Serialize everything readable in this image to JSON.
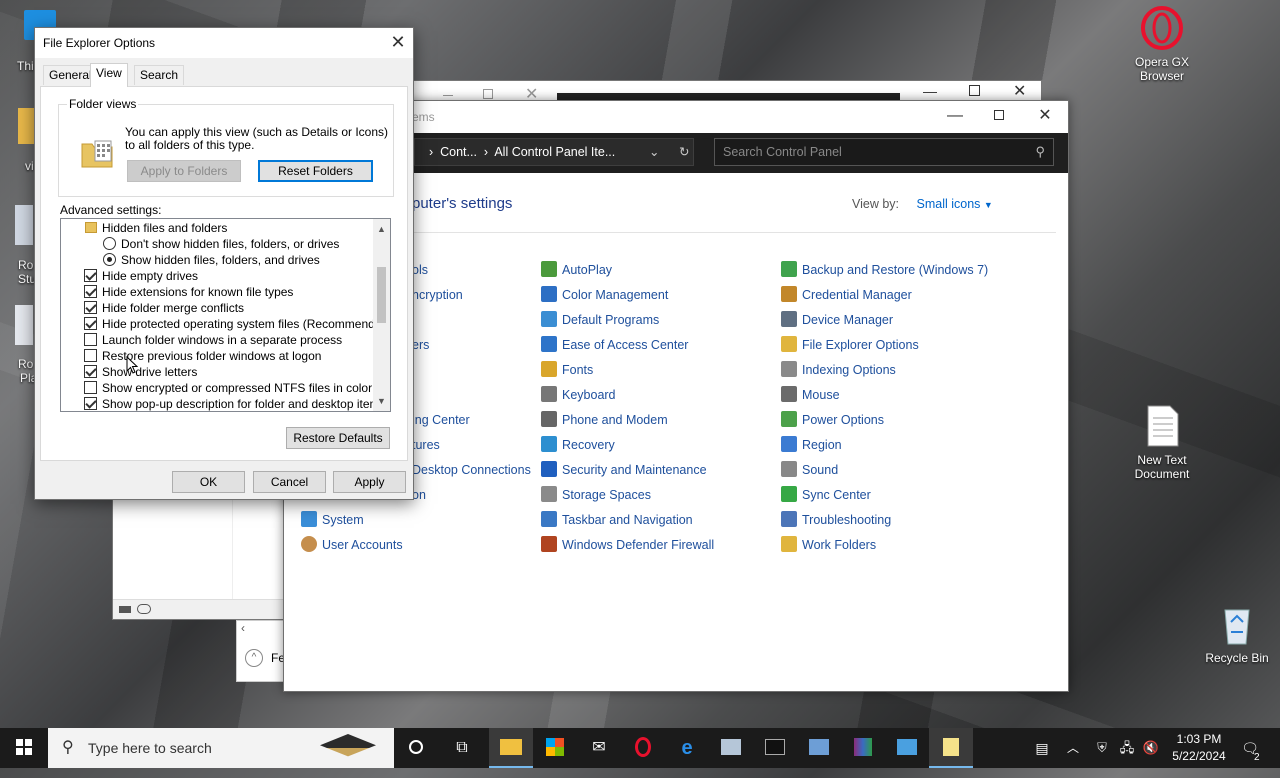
{
  "desktop": {
    "icons": [
      {
        "id": "opera",
        "label": "Opera GX Browser"
      },
      {
        "id": "textdoc",
        "label": "New Text Document"
      },
      {
        "id": "recycle",
        "label": "Recycle Bin"
      }
    ],
    "fragments": [
      "Thi",
      "vi",
      "Ro",
      "Stu",
      "Ro",
      "Pla"
    ]
  },
  "control_panel": {
    "title_fragment": "ems",
    "address_parts": [
      "Cont...",
      "All Control Panel Ite..."
    ],
    "search_placeholder": "Search Control Panel",
    "heading_fragment": "puter's settings",
    "view_by_label": "View by:",
    "view_by_value": "Small icons",
    "col1_fragments": [
      "ols",
      "ncryption",
      "ers",
      "ing Center",
      "tures",
      "Desktop Connections",
      "on"
    ],
    "col1": [
      "System",
      "User Accounts"
    ],
    "col2": [
      "AutoPlay",
      "Color Management",
      "Default Programs",
      "Ease of Access Center",
      "Fonts",
      "Keyboard",
      "Phone and Modem",
      "Recovery",
      "Security and Maintenance",
      "Storage Spaces",
      "Taskbar and Navigation",
      "Windows Defender Firewall"
    ],
    "col3": [
      "Backup and Restore (Windows 7)",
      "Credential Manager",
      "Device Manager",
      "File Explorer Options",
      "Indexing Options",
      "Mouse",
      "Power Options",
      "Region",
      "Sound",
      "Sync Center",
      "Troubleshooting",
      "Work Folders"
    ],
    "back_fragment": "Fe"
  },
  "dialog": {
    "title": "File Explorer Options",
    "tabs": [
      "General",
      "View",
      "Search"
    ],
    "active_tab": "View",
    "folder_views": {
      "legend": "Folder views",
      "description": "You can apply this view (such as Details or Icons) to all folders of this type.",
      "apply_label": "Apply to Folders",
      "reset_label": "Reset Folders"
    },
    "advanced_label": "Advanced settings:",
    "tree": [
      {
        "type": "folder",
        "label": "Hidden files and folders"
      },
      {
        "type": "radio",
        "checked": false,
        "label": "Don't show hidden files, folders, or drives"
      },
      {
        "type": "radio",
        "checked": true,
        "label": "Show hidden files, folders, and drives"
      },
      {
        "type": "check",
        "checked": true,
        "label": "Hide empty drives"
      },
      {
        "type": "check",
        "checked": true,
        "label": "Hide extensions for known file types"
      },
      {
        "type": "check",
        "checked": true,
        "label": "Hide folder merge conflicts"
      },
      {
        "type": "check",
        "checked": true,
        "label": "Hide protected operating system files (Recommended)"
      },
      {
        "type": "check",
        "checked": false,
        "label": "Launch folder windows in a separate process"
      },
      {
        "type": "check",
        "checked": false,
        "label": "Restore previous folder windows at logon"
      },
      {
        "type": "check",
        "checked": true,
        "label": "Show drive letters"
      },
      {
        "type": "check",
        "checked": false,
        "label": "Show encrypted or compressed NTFS files in color"
      },
      {
        "type": "check",
        "checked": true,
        "label": "Show pop-up description for folder and desktop items"
      }
    ],
    "restore_defaults_label": "Restore Defaults",
    "ok_label": "OK",
    "cancel_label": "Cancel",
    "apply_label": "Apply"
  },
  "taskbar": {
    "search_placeholder": "Type here to search",
    "time": "1:03 PM",
    "date": "5/22/2024",
    "notification_count": "2"
  }
}
